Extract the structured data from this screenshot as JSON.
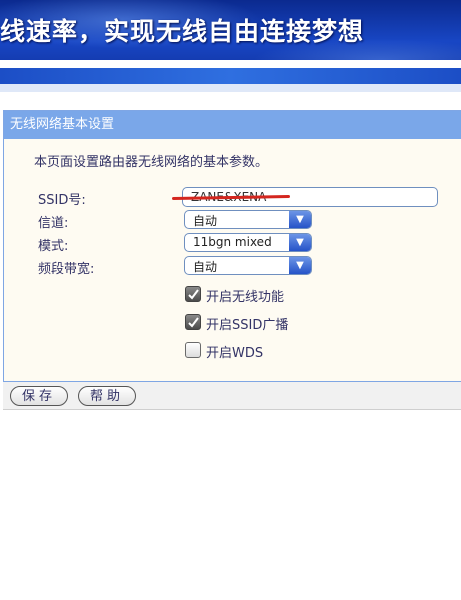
{
  "banner": {
    "slogan": "线速率，实现无线自由连接梦想"
  },
  "panel": {
    "title": "无线网络基本设置",
    "description": "本页面设置路由器无线网络的基本参数。"
  },
  "form": {
    "ssid": {
      "label": "SSID号:",
      "value": "ZANE&XENA"
    },
    "channel": {
      "label": "信道:",
      "value": "自动"
    },
    "mode": {
      "label": "模式:",
      "value": "11bgn mixed"
    },
    "bandwidth": {
      "label": "频段带宽:",
      "value": "自动"
    }
  },
  "checkboxes": [
    {
      "label": "开启无线功能",
      "checked": true
    },
    {
      "label": "开启SSID广播",
      "checked": true
    },
    {
      "label": "开启WDS",
      "checked": false
    }
  ],
  "footer": {
    "save_label": "保存",
    "help_label": "帮助"
  },
  "colors": {
    "header": "#7aa7e9",
    "banner": "#1846c4",
    "panel_bg": "#fefbf2",
    "accent": "#2553c8"
  }
}
